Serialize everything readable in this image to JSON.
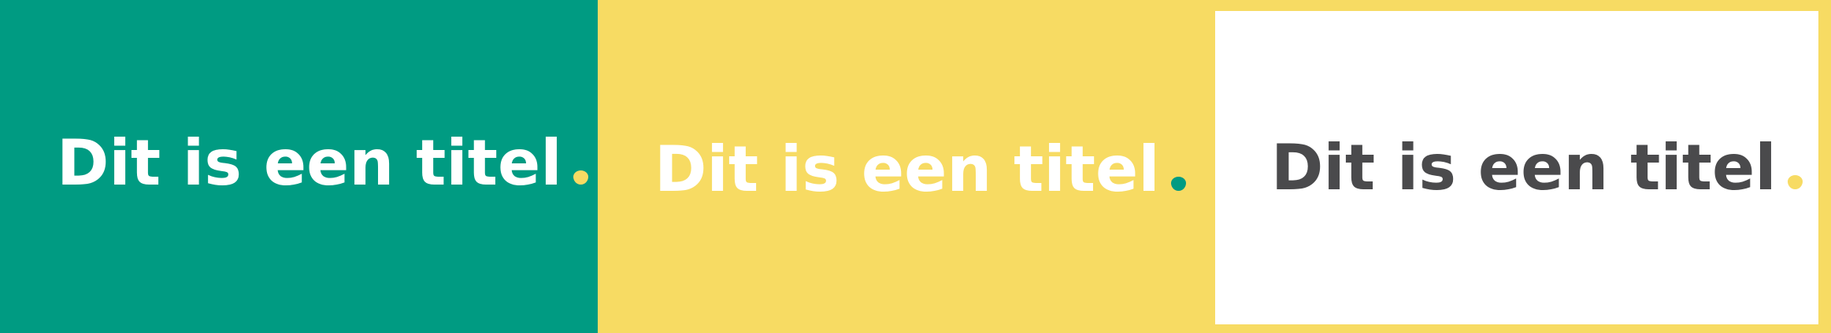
{
  "panels": [
    {
      "title": "Dit is een titel",
      "colors": {
        "background": "#009b82",
        "text": "#ffffff",
        "dot": "#f7db63"
      }
    },
    {
      "title": "Dit is een titel",
      "colors": {
        "background": "#f7db63",
        "text": "#ffffff",
        "dot": "#009b82"
      }
    },
    {
      "title": "Dit is een titel",
      "colors": {
        "background": "#ffffff",
        "frame": "#f7db63",
        "text": "#4a4a4c",
        "dot": "#f7db63"
      }
    }
  ]
}
